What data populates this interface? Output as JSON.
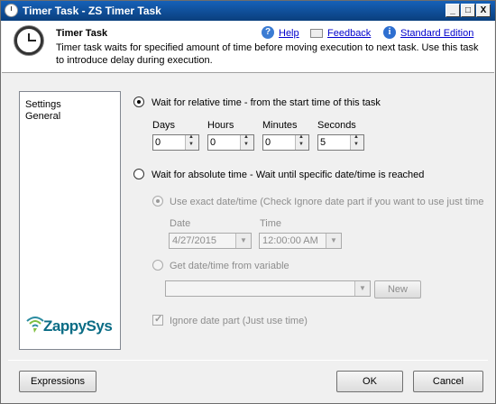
{
  "window": {
    "title": "Timer Task - ZS Timer Task",
    "controls": [
      "_",
      "□",
      "X"
    ]
  },
  "header": {
    "title": "Timer Task",
    "description": "Timer task waits for specified amount of time before moving execution to next task. Use this task to introduce delay during execution.",
    "help_label": "Help",
    "feedback_label": "Feedback",
    "edition_label": "Standard Edition"
  },
  "nav": {
    "items": [
      "Settings",
      "General"
    ]
  },
  "logo": {
    "text": "ZappySys"
  },
  "relative": {
    "label": "Wait for relative time - from the start time of this task",
    "selected": true,
    "fields": [
      {
        "label": "Days",
        "value": "0"
      },
      {
        "label": "Hours",
        "value": "0"
      },
      {
        "label": "Minutes",
        "value": "0"
      },
      {
        "label": "Seconds",
        "value": "5"
      }
    ]
  },
  "absolute": {
    "label": "Wait for absolute time - Wait until specific date/time is reached",
    "selected": false,
    "exact": {
      "label": "Use exact date/time (Check Ignore date part if you want to use just time)",
      "date_label": "Date",
      "date_value": "4/27/2015",
      "time_label": "Time",
      "time_value": "12:00:00 AM"
    },
    "variable": {
      "label": "Get date/time from variable",
      "value": "",
      "new_label": "New"
    },
    "ignore_date": {
      "label": "Ignore date part (Just use time)",
      "checked": true
    }
  },
  "footer": {
    "expressions_label": "Expressions",
    "ok_label": "OK",
    "cancel_label": "Cancel"
  },
  "colors": {
    "titlebar": "#0b4a8f",
    "link": "#0000cc",
    "logo": "#0a6c85",
    "disabled_text": "#8d8d8d"
  }
}
